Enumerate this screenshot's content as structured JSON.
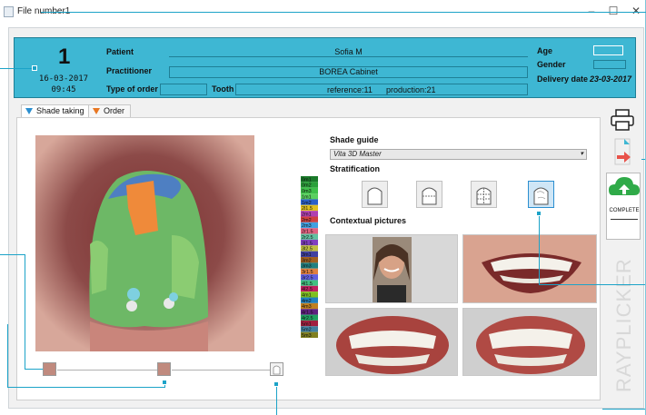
{
  "window": {
    "title": "File number1"
  },
  "header": {
    "file_number": "1",
    "date": "16-03-2017",
    "time": "09:45",
    "patient_label": "Patient",
    "patient_value": "Sofia M",
    "practitioner_label": "Practitioner",
    "practitioner_value": "BOREA Cabinet",
    "order_type_label": "Type of order",
    "tooth_label": "Tooth",
    "tooth_reference": "reference:11",
    "tooth_production": "production:21",
    "age_label": "Age",
    "gender_label": "Gender",
    "delivery_label": "Delivery date",
    "delivery_value": "23-03-2017"
  },
  "tabs": [
    {
      "label": "Shade taking",
      "active": true,
      "icon": "blue-triangle-icon",
      "color": "#2b8fd0"
    },
    {
      "label": "Order",
      "active": false,
      "icon": "orange-triangle-icon",
      "color": "#e87722"
    }
  ],
  "shade_scale": [
    "0m1",
    "0m2",
    "0m3",
    "1m1",
    "1m2",
    "2l1.5",
    "2m1",
    "2m2",
    "2m3",
    "2r1.5",
    "2r2.5",
    "3l1.5",
    "3l2.5",
    "3m1",
    "3m2",
    "3m3",
    "3r1.5",
    "3r2.5",
    "4l1.5",
    "4l2.5",
    "4m1",
    "4m2",
    "4m3",
    "4r1.5",
    "4r2.5",
    "5m1",
    "5m2",
    "5m3"
  ],
  "shade_guide": {
    "label": "Shade guide",
    "selected": "Vita 3D Master"
  },
  "stratification": {
    "label": "Stratification"
  },
  "contextual": {
    "label": "Contextual pictures"
  },
  "sidebar": {
    "complete_label": "COMPLETE",
    "brand": "RAYPLICKER"
  },
  "colors": {
    "header_bg": "#3eb7d3",
    "callout": "#1ca3c8",
    "selected_strat": "#cfe6f6"
  },
  "icons": [
    "print-icon",
    "send-icon",
    "cloud-upload-icon",
    "tooth-outline-icon"
  ]
}
